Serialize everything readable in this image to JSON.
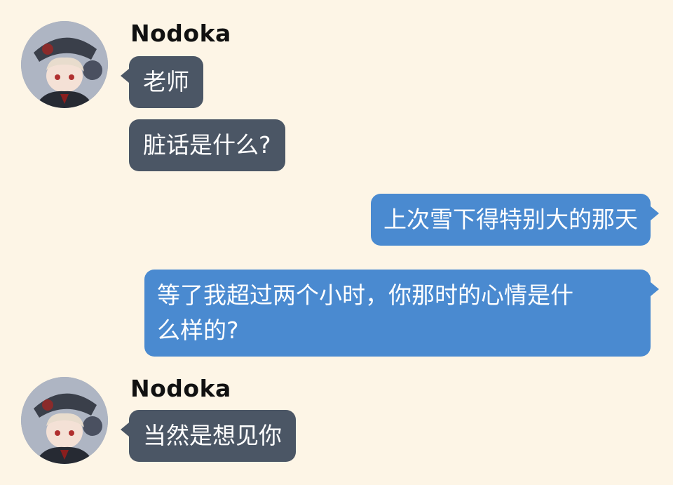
{
  "messages": [
    {
      "sender": "Nodoka",
      "text": "老师"
    },
    {
      "sender": "Nodoka",
      "text": "脏话是什么?"
    },
    {
      "sender": "me",
      "text": "上次雪下得特别大的那天"
    },
    {
      "sender": "me",
      "text_line1": "等了我超过两个小时，你那时的心情是什",
      "text_line2": "么样的?"
    },
    {
      "sender": "Nodoka",
      "text": "当然是想见你"
    }
  ],
  "colors": {
    "background": "#fdf5e6",
    "incoming_bubble": "#4b5665",
    "outgoing_bubble": "#4a8ad0"
  },
  "icons": {
    "avatar": "nodoka-avatar-icon"
  }
}
